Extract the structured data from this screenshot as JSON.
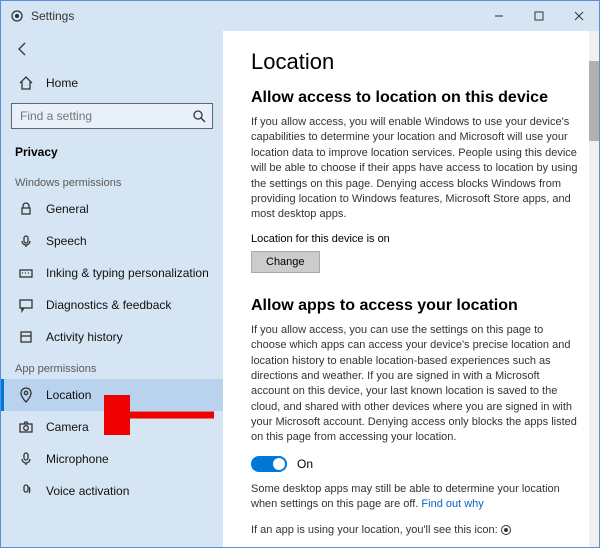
{
  "window": {
    "title": "Settings"
  },
  "sidebar": {
    "back_label": "Home",
    "search_placeholder": "Find a setting",
    "section_title": "Privacy",
    "group1_label": "Windows permissions",
    "group2_label": "App permissions",
    "items_win": {
      "general": "General",
      "speech": "Speech",
      "ink": "Inking & typing personalization",
      "diag": "Diagnostics & feedback",
      "activity": "Activity history"
    },
    "items_app": {
      "location": "Location",
      "camera": "Camera",
      "microphone": "Microphone",
      "voice": "Voice activation"
    }
  },
  "main": {
    "title": "Location",
    "section1_title": "Allow access to location on this device",
    "section1_body": "If you allow access, you will enable Windows to use your device's capabilities to determine your location and Microsoft will use your location data to improve location services. People using this device will be able to choose if their apps have access to location by using the settings on this page. Denying access blocks Windows from providing location to Windows features, Microsoft Store apps, and most desktop apps.",
    "device_status": "Location for this device is on",
    "change_button": "Change",
    "section2_title": "Allow apps to access your location",
    "section2_body": "If you allow access, you can use the settings on this page to choose which apps can access your device's precise location and location history to enable location-based experiences such as directions and weather. If you are signed in with a Microsoft account on this device, your last known location is saved to the cloud, and shared with other devices where you are signed in with your Microsoft account. Denying access only blocks the apps listed on this page from accessing your location.",
    "toggle_label": "On",
    "desktop_note": "Some desktop apps may still be able to determine your location when settings on this page are off. ",
    "find_out": "Find out why",
    "using_icon_note": "If an app is using your location, you'll see this icon: "
  }
}
